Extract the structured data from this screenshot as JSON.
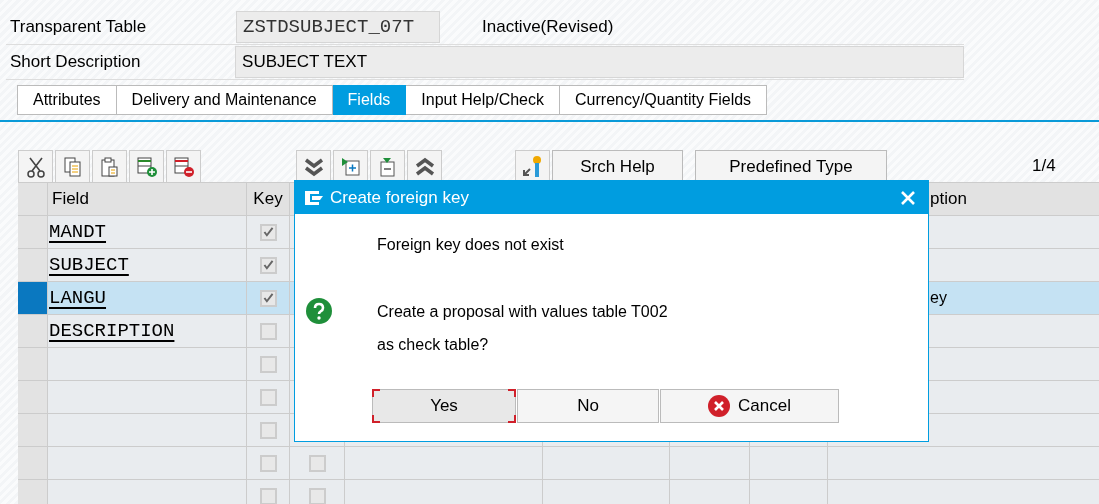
{
  "header": {
    "object_type_label": "Transparent Table",
    "table_name": "ZSTDSUBJECT_07T",
    "status": "Inactive(Revised)",
    "description_label": "Short Description",
    "description": "SUBJECT TEXT"
  },
  "tabs": [
    {
      "label": "Attributes",
      "selected": false
    },
    {
      "label": "Delivery and Maintenance",
      "selected": false
    },
    {
      "label": "Fields",
      "selected": true
    },
    {
      "label": "Input Help/Check",
      "selected": false
    },
    {
      "label": "Currency/Quantity Fields",
      "selected": false
    }
  ],
  "toolbar": {
    "buttons": [
      "Srch Help",
      "Predefined Type"
    ],
    "page_indicator": "1/4"
  },
  "table": {
    "column_headers": {
      "field": "Field",
      "key": "Key",
      "column_9": "ption"
    },
    "rows": [
      {
        "field": "MANDT",
        "key": true,
        "selected": false
      },
      {
        "field": "SUBJECT",
        "key": true,
        "selected": false
      },
      {
        "field": "LANGU",
        "key": true,
        "selected": true,
        "column_9": "ey"
      },
      {
        "field": "DESCRIPTION",
        "key": false,
        "selected": false
      },
      {
        "key": false,
        "selected": false
      },
      {
        "key": false,
        "selected": false
      },
      {
        "key": false,
        "selected": false
      },
      {
        "key": false,
        "initial": false,
        "selected": false
      },
      {
        "key": false,
        "initial": false,
        "selected": false
      }
    ]
  },
  "dialog": {
    "title": "Create foreign key",
    "message": [
      "Foreign key does not exist",
      "Create a proposal with values table T002",
      "as check table?"
    ],
    "buttons": [
      {
        "label": "Yes",
        "kind": "plain",
        "focused": true
      },
      {
        "label": "No",
        "kind": "plain",
        "focused": false
      },
      {
        "label": "Cancel",
        "kind": "cancel",
        "focused": false
      }
    ]
  }
}
